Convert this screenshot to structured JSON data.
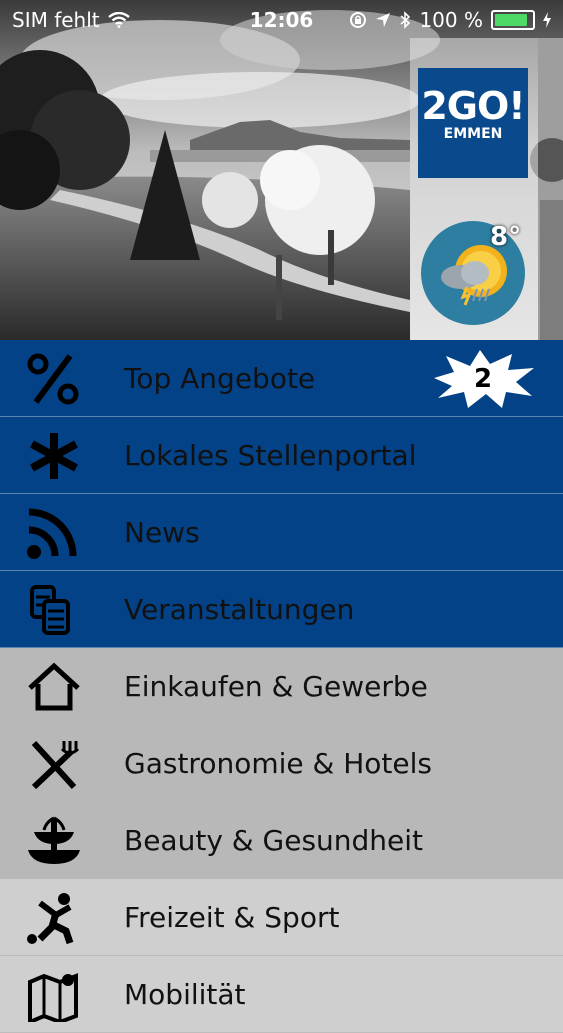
{
  "status_bar": {
    "carrier": "SIM fehlt",
    "time": "12:06",
    "battery": "100 %"
  },
  "header": {
    "logo_main": "2GO!",
    "logo_sub": "EMMEN",
    "temperature": "8°",
    "weather_icon": "sun-cloud-rain-icon"
  },
  "menu": {
    "items": [
      {
        "label": "Top Angebote",
        "icon": "percent-icon",
        "badge": "2"
      },
      {
        "label": "Lokales Stellenportal",
        "icon": "asterisk-icon"
      },
      {
        "label": "News",
        "icon": "rss-icon"
      },
      {
        "label": "Veranstaltungen",
        "icon": "tickets-icon"
      },
      {
        "label": "Einkaufen & Gewerbe",
        "icon": "house-icon"
      },
      {
        "label": "Gastronomie & Hotels",
        "icon": "knife-fork-icon"
      },
      {
        "label": "Beauty & Gesundheit",
        "icon": "fountain-icon"
      },
      {
        "label": "Freizeit & Sport",
        "icon": "person-ball-icon"
      },
      {
        "label": "Mobilität",
        "icon": "map-icon"
      }
    ]
  },
  "colors": {
    "blue_items": "#034287",
    "gray_items": "#b8b8b8",
    "logo_bg": "#0a4a8c"
  }
}
